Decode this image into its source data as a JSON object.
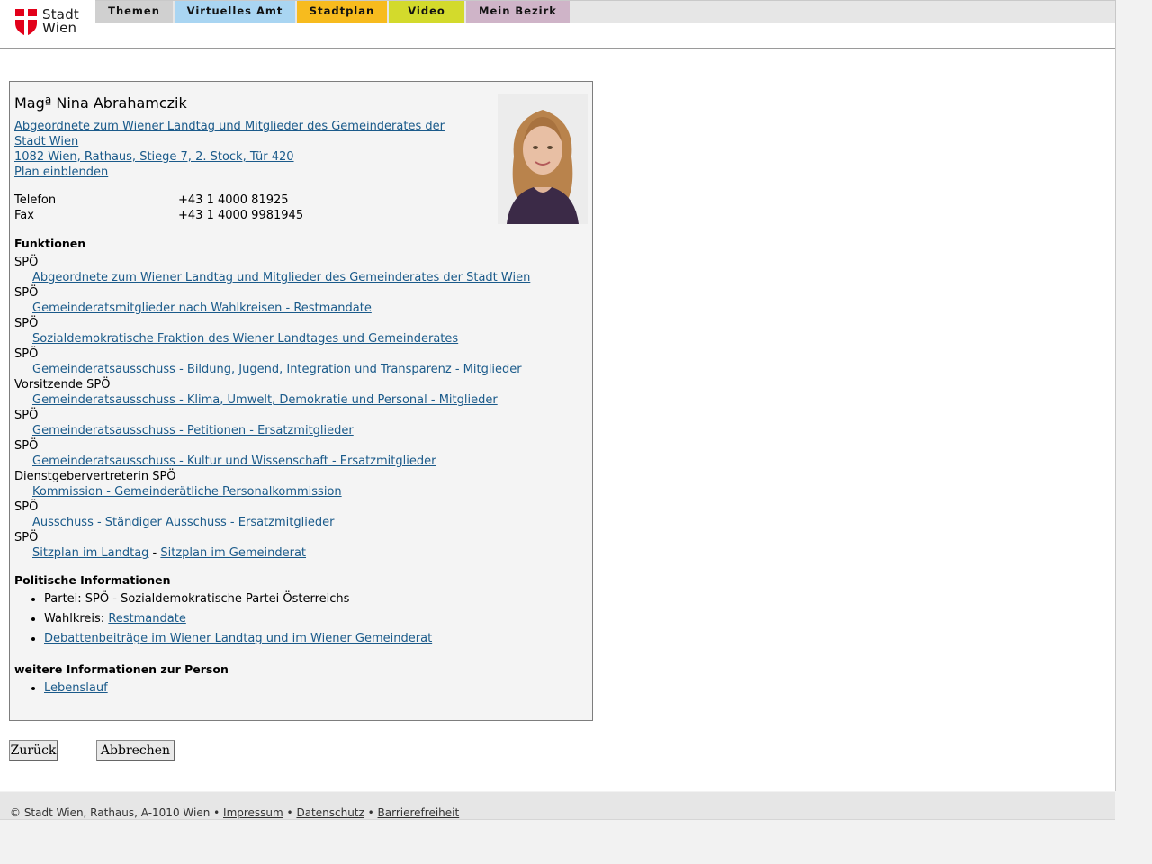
{
  "header": {
    "logo_text_line1": "Stadt",
    "logo_text_line2": "Wien",
    "tabs": [
      {
        "label": "Themen",
        "color": "#d0d0d0"
      },
      {
        "label": "Virtuelles Amt",
        "color": "#a9d5f2"
      },
      {
        "label": "Stadtplan",
        "color": "#f7bb1e"
      },
      {
        "label": "Video",
        "color": "#d3da2c"
      },
      {
        "label": "Mein Bezirk",
        "color": "#cfb4c8"
      }
    ]
  },
  "person": {
    "name": "Magª Nina Abrahamczik",
    "role_line1": "Abgeordnete zum Wiener Landtag und Mitglieder des Gemeinderates der",
    "role_line2": "Stadt Wien ",
    "address": "1082 Wien, Rathaus, Stiege 7, 2. Stock, Tür 420",
    "plan_link": "Plan einblenden",
    "phone_label": "Telefon",
    "phone_value": "+43 1 4000 81925",
    "fax_label": "Fax",
    "fax_value": "+43 1 4000 9981945",
    "photo_alt": "Foto"
  },
  "funktionen": {
    "heading": "Funktionen",
    "items": [
      {
        "party": "SPÖ",
        "link": "Abgeordnete zum Wiener Landtag und Mitglieder des Gemeinderates der Stadt Wien"
      },
      {
        "party": "SPÖ",
        "link": "Gemeinderatsmitglieder nach Wahlkreisen - Restmandate"
      },
      {
        "party": "SPÖ",
        "link": "Sozialdemokratische Fraktion des Wiener Landtages und Gemeinderates"
      },
      {
        "party": "SPÖ",
        "link": "Gemeinderatsausschuss - Bildung, Jugend, Integration und Transparenz - Mitglieder"
      },
      {
        "party": "Vorsitzende SPÖ",
        "link": "Gemeinderatsausschuss - Klima, Umwelt, Demokratie und Personal - Mitglieder"
      },
      {
        "party": "SPÖ",
        "link": "Gemeinderatsausschuss - Petitionen - Ersatzmitglieder"
      },
      {
        "party": "SPÖ",
        "link": "Gemeinderatsausschuss - Kultur und Wissenschaft - Ersatzmitglieder"
      },
      {
        "party": "Dienstgebervertreterin SPÖ",
        "link": "Kommission - Gemeinderätliche Personalkommission"
      },
      {
        "party": "SPÖ",
        "link": "Ausschuss - Ständiger Ausschuss - Ersatzmitglieder"
      }
    ],
    "last_party": "SPÖ",
    "sitzplan_landtag": "Sitzplan im Landtag",
    "sitzplan_sep": " - ",
    "sitzplan_gemeinderat": "Sitzplan im Gemeinderat"
  },
  "politisch": {
    "heading": "Politische Informationen",
    "partei_text": "Partei: SPÖ - Sozialdemokratische Partei Österreichs",
    "wahlkreis_label": "Wahlkreis: ",
    "wahlkreis_link": "Restmandate",
    "debatten_link": "Debattenbeiträge im Wiener Landtag und im Wiener Gemeinderat"
  },
  "weitere": {
    "heading": "weitere Informationen zur Person",
    "lebenslauf_link": "Lebenslauf"
  },
  "buttons": {
    "back": "Zurück",
    "cancel": "Abbrechen"
  },
  "footer": {
    "copyright": "© Stadt Wien, Rathaus, A-1010 Wien",
    "sep": " • ",
    "impressum": "Impressum",
    "datenschutz": "Datenschutz",
    "barrierefreiheit": "Barrierefreiheit"
  },
  "colors": {
    "link": "#1a5a8a",
    "card_bg": "#f4f4f4",
    "logo_red": "#e2001a"
  }
}
